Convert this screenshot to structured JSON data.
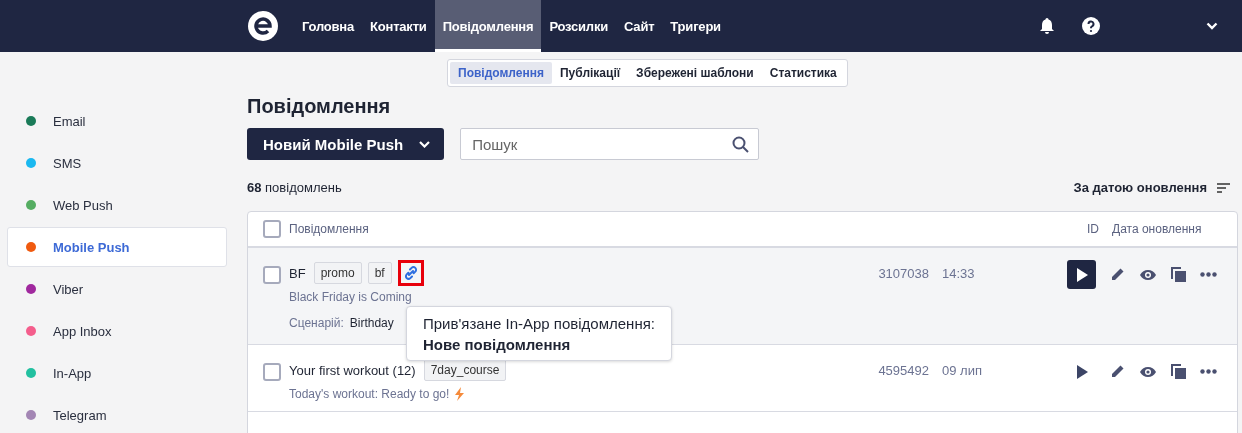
{
  "nav": {
    "items": [
      {
        "label": "Головна",
        "selected": false
      },
      {
        "label": "Контакти",
        "selected": false
      },
      {
        "label": "Повідомлення",
        "selected": true
      },
      {
        "label": "Розсилки",
        "selected": false
      },
      {
        "label": "Сайт",
        "selected": false
      },
      {
        "label": "Тригери",
        "selected": false
      }
    ]
  },
  "subtabs": [
    {
      "label": "Повідомлення",
      "selected": true
    },
    {
      "label": "Публікації",
      "selected": false
    },
    {
      "label": "Збережені шаблони",
      "selected": false
    },
    {
      "label": "Статистика",
      "selected": false
    }
  ],
  "sidebar": {
    "items": [
      {
        "label": "Email",
        "color": "#1a7a58",
        "selected": false
      },
      {
        "label": "SMS",
        "color": "#1ab8f0",
        "selected": false
      },
      {
        "label": "Web Push",
        "color": "#55ad62",
        "selected": false
      },
      {
        "label": "Mobile Push",
        "color": "#f05a0f",
        "selected": true
      },
      {
        "label": "Viber",
        "color": "#a0289e",
        "selected": false
      },
      {
        "label": "App Inbox",
        "color": "#f45d8c",
        "selected": false
      },
      {
        "label": "In-App",
        "color": "#22c0a0",
        "selected": false
      },
      {
        "label": "Telegram",
        "color": "#a386b4",
        "selected": false
      }
    ]
  },
  "page_title": "Повідомлення",
  "new_button": "Новий Mobile Push",
  "search": {
    "placeholder": "Пошук"
  },
  "count": {
    "number": "68",
    "label": "повідомлень"
  },
  "sort": "За датою оновлення",
  "table": {
    "select_all_checked": false,
    "columns": [
      "Повідомлення",
      "ID",
      "Дата оновлення"
    ],
    "rows": [
      {
        "checked": false,
        "title": "BF",
        "tags": [
          "promo",
          "bf"
        ],
        "linked": true,
        "highlighted": true,
        "subtitle": "Black Friday is Coming",
        "scenario_label": "Сценарій:",
        "scenario": "Birthday",
        "lightning": false,
        "id": "3107038",
        "date": "14:33",
        "hovered": true
      },
      {
        "checked": false,
        "title": "Your first workout (12)",
        "tags": [
          "7day_course"
        ],
        "subtitle": "Today's workout: Ready to go!",
        "lightning": true,
        "id": "4595492",
        "date": "09 лип",
        "hovered": false
      }
    ]
  },
  "tooltip": {
    "line": "Прив'язане In-App повідомлення:",
    "bold": "Нове повідомлення"
  }
}
